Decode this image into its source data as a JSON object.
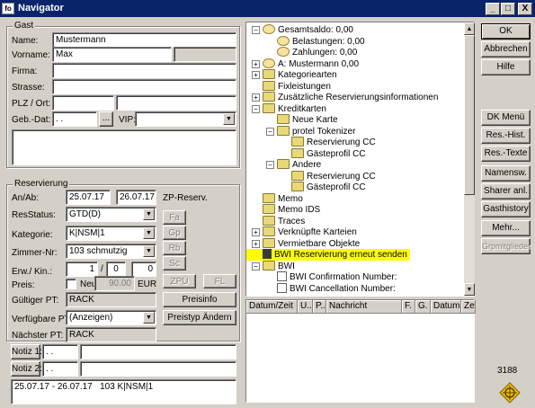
{
  "window": {
    "icon": "fo",
    "title": "Navigator",
    "min": "_",
    "max": "□",
    "close": "X"
  },
  "gast": {
    "legend": "Gast",
    "name_label": "Name:",
    "name": "Mustermann",
    "vorname_label": "Vorname:",
    "vorname": "Max",
    "firma_label": "Firma:",
    "strasse_label": "Strasse:",
    "plz_label": "PLZ / Ort:",
    "geb_label": "Geb.-Dat:",
    "geb_value": ". .",
    "geb_btn": "...",
    "vip_label": "VIP:"
  },
  "res": {
    "legend": "Reservierung",
    "anab_label": "An/Ab:",
    "an": "25.07.17",
    "ab": "26.07.17",
    "zp_label": "ZP-Reserv.",
    "status_label": "ResStatus:",
    "status": "GTD(D)",
    "kat_label": "Kategorie:",
    "kat": "K|NSM|1",
    "zimmer_label": "Zimmer-Nr:",
    "zimmer": "103 schmutzig",
    "erw_label": "Erw./ Kin.:",
    "erw": "1",
    "kin1": "0",
    "kin2": "0",
    "preis_label": "Preis:",
    "neu_label": "Neu",
    "preis": "90.00",
    "currency": "EUR",
    "gpt_label": "Gültiger PT:",
    "gpt": "RACK",
    "vpt_label": "Verfügbare PT:",
    "vpt": "(Anzeigen)",
    "npt_label": "Nächster PT:",
    "npt": "RACK",
    "preisinfo": "Preisinfo",
    "preistyp": "Preistyp Ändern",
    "zp_fa": "Fa",
    "zp_gp": "Gp",
    "zp_rb": "Rb",
    "zp_sc": "Sc",
    "zpu": "ZPÜ",
    "fl": "FL"
  },
  "notiz": {
    "n1_label": "Notiz 1:",
    "n1": ". .",
    "n2_label": "Notiz 2:",
    "n2": ". ."
  },
  "summary": "25.07.17 - 26.07.17   103 K|NSM|1",
  "tree": [
    {
      "label": "Gesamtsaldo: 0,00",
      "exp": "−",
      "icon": "check-icon"
    },
    {
      "label": "Belastungen: 0,00",
      "icon": "coins-icon"
    },
    {
      "label": "Zahlungen: 0,00",
      "icon": "coins-icon"
    },
    {
      "label": "A: Mustermann 0,00",
      "exp": "+",
      "icon": "check-icon"
    },
    {
      "label": "Kategoriearten",
      "exp": "+",
      "icon": "folder-icon"
    },
    {
      "label": "Fixleistungen",
      "icon": "folder-icon"
    },
    {
      "label": "Zusätzliche Reservierungsinformationen",
      "exp": "+",
      "icon": "folder-icon"
    },
    {
      "label": "Kreditkarten",
      "exp": "−",
      "icon": "folder-icon"
    },
    {
      "label": "Neue Karte",
      "icon": "folder-icon"
    },
    {
      "label": "protel Tokenizer",
      "exp": "−",
      "icon": "folder-icon"
    },
    {
      "label": "Reservierung CC",
      "icon": "folder-icon"
    },
    {
      "label": "Gästeprofil CC",
      "icon": "folder-icon"
    },
    {
      "label": "Andere",
      "exp": "−",
      "icon": "folder-icon"
    },
    {
      "label": "Reservierung CC",
      "icon": "folder-icon"
    },
    {
      "label": "Gästeprofil CC",
      "icon": "folder-icon"
    },
    {
      "label": "Memo",
      "icon": "folder-icon"
    },
    {
      "label": "Memo IDS",
      "icon": "folder-icon"
    },
    {
      "label": "Traces",
      "icon": "folder-icon"
    },
    {
      "label": "Verknüpfte Karteien",
      "exp": "+",
      "icon": "folder-icon"
    },
    {
      "label": "Vermietbare Objekte",
      "exp": "+",
      "icon": "folder-icon"
    },
    {
      "label": "BWI Reservierung erneut senden",
      "icon": "lightning-icon",
      "highlight": "#ffff00"
    },
    {
      "label": "BWI",
      "exp": "−",
      "icon": "folder-icon"
    },
    {
      "label": "BWI Confirmation Number:",
      "icon": "doc-icon"
    },
    {
      "label": "BWI Cancellation Number:",
      "icon": "doc-icon"
    }
  ],
  "grid_cols": [
    "Datum/Zeit",
    "U..",
    "P..",
    "Nachricht",
    "F.",
    "G.",
    "Datum",
    "Ze"
  ],
  "buttons": {
    "ok": "OK",
    "abbrechen": "Abbrechen",
    "hilfe": "Hilfe",
    "dkmenu": "DK Menü",
    "reshist": "Res.-Hist.",
    "restexte": "Res.-Texte",
    "namensw": "Namensw.",
    "sharer": "Sharer anl.",
    "gasthistory": "Gasthistory",
    "mehr": "Mehr...",
    "grpmitglieder": "Grpmitglieder"
  },
  "res_number": "3188"
}
